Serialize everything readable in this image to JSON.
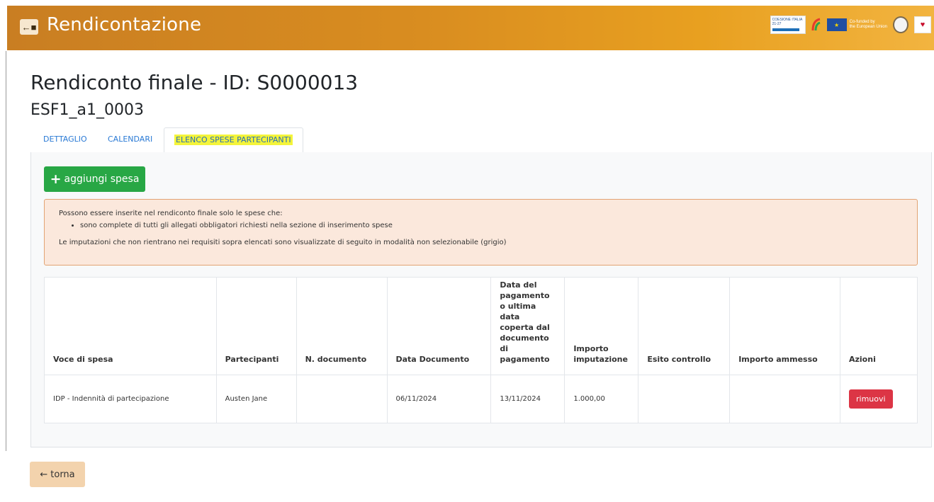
{
  "header": {
    "back_icon": "←■",
    "title": "Rendicontazione",
    "logos": {
      "coesione_text": "COESIONE ITALIA 21-27",
      "eu_text_1": "Co-funded by",
      "eu_text_2": "the European Union",
      "province_glyph": "♥"
    },
    "color": "#d98d20"
  },
  "page": {
    "title": "Rendiconto finale - ID: S0000013",
    "subtitle": "ESF1_a1_0003"
  },
  "tabs": [
    {
      "label": "DETTAGLIO"
    },
    {
      "label": "CALENDARI"
    },
    {
      "label": "ELENCO SPESE PARTECIPANTI",
      "active": true
    }
  ],
  "add_button": {
    "icon": "+",
    "label": "aggiungi spesa"
  },
  "alert": {
    "intro": "Possono essere inserite nel rendiconto finale solo le spese che:",
    "item": "sono complete di tutti gli allegati obbligatori richiesti nella sezione di inserimento spese",
    "note": "Le imputazioni che non rientrano nei requisiti sopra elencati sono visualizzate di seguito in modalità non selezionabile (grigio)"
  },
  "table": {
    "headers": [
      "Voce di spesa",
      "Partecipanti",
      "N. documento",
      "Data Documento",
      "Data del pagamento o ultima data coperta dal documento di pagamento",
      "Importo imputazione",
      "Esito controllo",
      "Importo ammesso",
      "Azioni"
    ],
    "rows": [
      {
        "voce": "IDP - Indennità di partecipazione",
        "partecipanti": "Austen Jane",
        "n_documento": "",
        "data_documento": "06/11/2024",
        "data_pagamento": "13/11/2024",
        "importo": "1.000,00",
        "esito": "",
        "ammesso": "",
        "azione": "rimuovi"
      }
    ]
  },
  "footer": {
    "back_icon": "←",
    "back_label": "torna"
  }
}
